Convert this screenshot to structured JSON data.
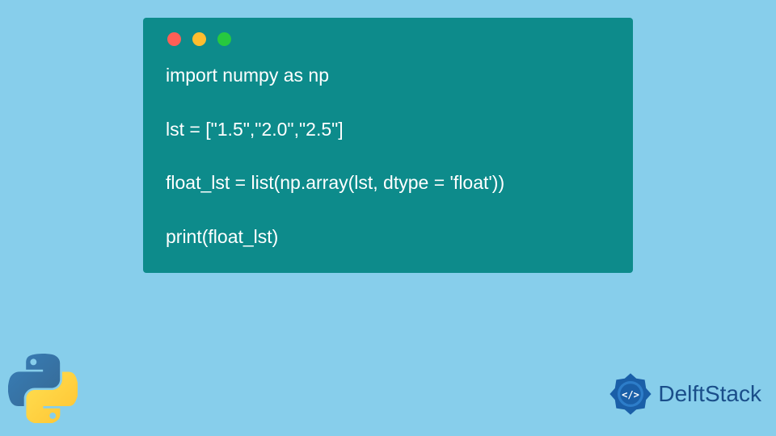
{
  "code": {
    "line1": "import numpy as np",
    "line2": "",
    "line3": "lst = [\"1.5\",\"2.0\",\"2.5\"]",
    "line4": "",
    "line5": "float_lst = list(np.array(lst, dtype = 'float'))",
    "line6": "",
    "line7": "print(float_lst)"
  },
  "branding": {
    "name": "DelftStack"
  },
  "colors": {
    "background": "#87ceeb",
    "codeBackground": "#0d8b8b",
    "codeText": "#ffffff",
    "brandText": "#1a4e8a"
  }
}
